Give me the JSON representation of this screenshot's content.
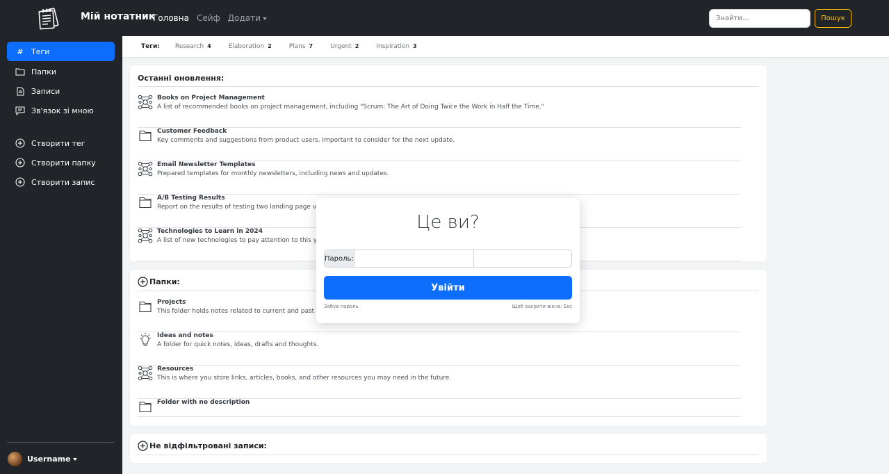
{
  "navbar": {
    "brand": "Мій нотатник",
    "links": [
      "Головна",
      "Сейф",
      "Додати"
    ],
    "search_placeholder": "Знайти...",
    "search_button": "Пошук"
  },
  "sidebar": {
    "items": [
      "Теги",
      "Папки",
      "Записи",
      "Зв'язок зі мною",
      "Створити тег",
      "Створити папку",
      "Створити запис"
    ],
    "username": "Username"
  },
  "tags": {
    "label": "Теги:",
    "items": [
      {
        "name": "Research",
        "count": "4"
      },
      {
        "name": "Elaboration",
        "count": "2"
      },
      {
        "name": "Plans",
        "count": "7"
      },
      {
        "name": "Urgent",
        "count": "2"
      },
      {
        "name": "Inspiration",
        "count": "3"
      }
    ]
  },
  "recent": {
    "title": "Останні оновлення:",
    "items": [
      {
        "title": "Books on Project Management",
        "desc": "A list of recommended books on project management, including \"Scrum: The Art of Doing Twice the Work in Half the Time.\"",
        "icon": "network-icon"
      },
      {
        "title": "Customer Feedback",
        "desc": "Key comments and suggestions from product users. Important to consider for the next update.",
        "icon": "folder-icon"
      },
      {
        "title": "Email Newsletter Templates",
        "desc": "Prepared templates for monthly newsletters, including news and updates.",
        "icon": "network-icon"
      },
      {
        "title": "A/B Testing Results",
        "desc": "Report on the results of testing two landing page ver",
        "icon": "folder-icon"
      },
      {
        "title": "Technologies to Learn in 2024",
        "desc": "A list of new technologies to pay attention to this ye",
        "icon": "network-icon"
      }
    ]
  },
  "folders": {
    "title": "Папки:",
    "items": [
      {
        "title": "Projects",
        "desc": "This folder holds notes related to current and past pr",
        "icon": "folder-icon"
      },
      {
        "title": "Ideas and notes",
        "desc": "A folder for quick notes, ideas, drafts and thoughts.",
        "icon": "lightbulb-icon"
      },
      {
        "title": "Resources",
        "desc": "This is where you store links, articles, books, and other resources you may need in the future.",
        "icon": "network-icon"
      },
      {
        "title": "Folder with no description",
        "desc": "",
        "icon": "folder-icon"
      }
    ]
  },
  "unfiltered": {
    "title": "Не відфільтровані записи:"
  },
  "modal": {
    "title": "Це ви?",
    "password_label": "Пароль:",
    "login_button": "Увійти",
    "forgot": "Забув пароль",
    "esc_hint": "Щоб закрити вікно: Esc"
  }
}
